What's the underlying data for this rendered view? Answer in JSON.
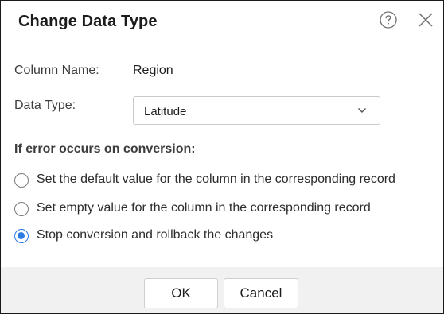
{
  "dialog": {
    "title": "Change Data Type",
    "help_icon": "question-circle-icon",
    "close_icon": "close-x-icon"
  },
  "form": {
    "column_name_label": "Column Name:",
    "column_name_value": "Region",
    "data_type_label": "Data Type:",
    "data_type_selected": "Latitude",
    "data_type_chevron_icon": "chevron-down-icon"
  },
  "error_section": {
    "heading": "If error occurs on conversion:",
    "options": [
      {
        "label": "Set the default value for the column in the corresponding record",
        "selected": false
      },
      {
        "label": "Set empty value for the column in the corresponding record",
        "selected": false
      },
      {
        "label": "Stop conversion and rollback the changes",
        "selected": true
      }
    ]
  },
  "footer": {
    "ok_label": "OK",
    "cancel_label": "Cancel"
  },
  "colors": {
    "accent": "#2a7be4",
    "footer_bg": "#f1f1f1",
    "border": "#1a1a1a"
  }
}
